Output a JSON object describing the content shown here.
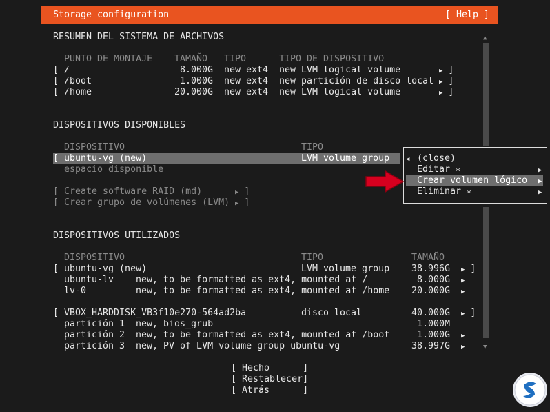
{
  "header": {
    "title": "Storage configuration",
    "help": "[ Help ]"
  },
  "filesystem_summary": {
    "heading": "RESUMEN DEL SISTEMA DE ARCHIVOS",
    "columns": [
      "PUNTO DE MONTAJE",
      "TAMAÑO",
      "TIPO",
      "TIPO DE DISPOSITIVO"
    ],
    "rows": [
      {
        "mount": "/",
        "size": "8.000G",
        "type": "new ext4",
        "device_type": "new LVM logical volume"
      },
      {
        "mount": "/boot",
        "size": "1.000G",
        "type": "new ext4",
        "device_type": "new partición de disco local"
      },
      {
        "mount": "/home",
        "size": "20.000G",
        "type": "new ext4",
        "device_type": "new LVM logical volume"
      }
    ]
  },
  "available_devices": {
    "heading": "DISPOSITIVOS DISPONIBLES",
    "col_device": "DISPOSITIVO",
    "col_type": "TIPO",
    "row": {
      "name": "ubuntu-vg (new)",
      "type": "LVM volume group"
    },
    "free_space": "espacio disponible",
    "actions": [
      "Create software RAID (md)",
      "Crear grupo de volúmenes (LVM)"
    ]
  },
  "context_menu": {
    "items": [
      "(close)",
      "Editar ⁎",
      "Crear volumen lógico",
      "Eliminar ⁎"
    ],
    "selected": "Crear volumen lógico"
  },
  "used_devices": {
    "heading": "DISPOSITIVOS UTILIZADOS",
    "col_device": "DISPOSITIVO",
    "col_type": "TIPO",
    "col_size": "TAMAÑO",
    "groups": [
      {
        "device": "ubuntu-vg (new)",
        "type": "LVM volume group",
        "size": "38.996G",
        "children": [
          {
            "name": "ubuntu-lv",
            "desc": "new, to be formatted as ext4, mounted at /",
            "size": "8.000G"
          },
          {
            "name": "lv-0",
            "desc": "new, to be formatted as ext4, mounted at /home",
            "size": "20.000G"
          }
        ]
      },
      {
        "device": "VBOX_HARDDISK_VB3f10e270-564ad2ba",
        "type": "disco local",
        "size": "40.000G",
        "children": [
          {
            "name": "partición 1",
            "desc": "new, bios_grub",
            "size": "1.000M"
          },
          {
            "name": "partición 2",
            "desc": "new, to be formatted as ext4, mounted at /boot",
            "size": "1.000G"
          },
          {
            "name": "partición 3",
            "desc": "new, PV of LVM volume group ubuntu-vg",
            "size": "38.997G"
          }
        ]
      }
    ]
  },
  "buttons": {
    "done": "Hecho",
    "reset": "Restablecer",
    "back": "Atrás"
  },
  "colors": {
    "accent": "#e95420",
    "background": "#1b1b1b",
    "highlight": "#6e6e6e",
    "arrow": "#d7001f"
  }
}
